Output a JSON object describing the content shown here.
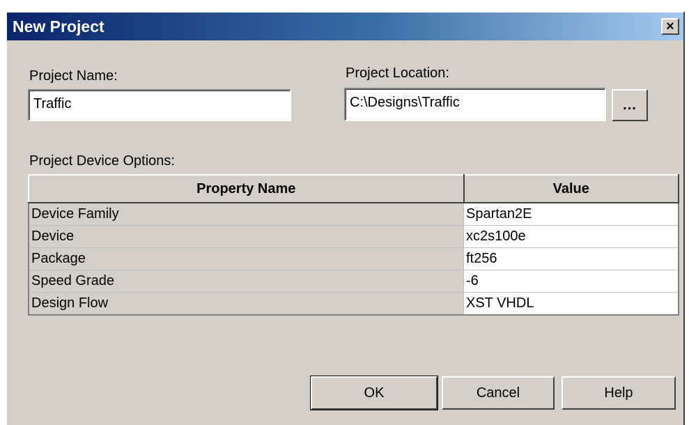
{
  "window": {
    "title": "New Project",
    "close_label": "×"
  },
  "project_name": {
    "label": "Project Name:",
    "value": "Traffic"
  },
  "project_location": {
    "label": "Project Location:",
    "value": "C:\\Designs\\Traffic",
    "browse_label": "..."
  },
  "device_options": {
    "label": "Project Device Options:",
    "columns": [
      "Property Name",
      "Value"
    ],
    "rows": [
      {
        "name": "Device Family",
        "value": "Spartan2E"
      },
      {
        "name": "Device",
        "value": "xc2s100e"
      },
      {
        "name": "Package",
        "value": "ft256"
      },
      {
        "name": "Speed Grade",
        "value": "-6"
      },
      {
        "name": "Design Flow",
        "value": "XST VHDL"
      }
    ]
  },
  "buttons": {
    "ok": "OK",
    "cancel": "Cancel",
    "help": "Help"
  },
  "colors": {
    "title_gradient_start": "#0a246a",
    "title_gradient_end": "#a6caf0",
    "dialog_face": "#d4d0c8"
  }
}
